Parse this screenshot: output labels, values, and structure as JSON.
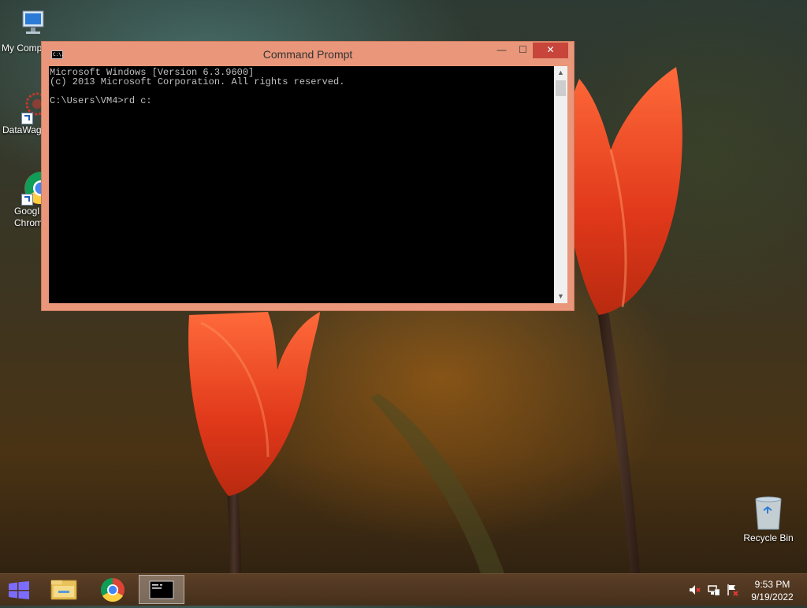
{
  "desktop": {
    "icons": [
      {
        "label": "My Comp",
        "icon": "computer-icon"
      },
      {
        "label": "DataWag",
        "icon": "datawag-icon"
      },
      {
        "label": "Googl\nChrom",
        "icon": "chrome-icon"
      },
      {
        "label": "Recycle Bin",
        "icon": "recycle-bin-icon"
      }
    ]
  },
  "window": {
    "title": "Command Prompt",
    "icon_text": "C:\\.",
    "buttons": {
      "minimize": "—",
      "maximize": "☐",
      "close": "✕"
    },
    "console_text": "Microsoft Windows [Version 6.3.9600]\n(c) 2013 Microsoft Corporation. All rights reserved.\n\nC:\\Users\\VM4>rd c:",
    "scroll": {
      "up": "▲",
      "down": "▼"
    }
  },
  "taskbar": {
    "items": [
      {
        "icon": "start-windows-icon"
      },
      {
        "icon": "file-explorer-icon"
      },
      {
        "icon": "chrome-icon"
      },
      {
        "icon": "command-prompt-icon",
        "active": true
      }
    ],
    "tray": [
      "volume-muted-icon",
      "network-icon",
      "action-center-flag-icon"
    ],
    "clock": {
      "time": "9:53 PM",
      "date": "9/19/2022"
    }
  },
  "colors": {
    "window_frame": "#e9967a",
    "close_button": "#c7453b",
    "console_bg": "#000000",
    "console_fg": "#c0c0c0"
  }
}
